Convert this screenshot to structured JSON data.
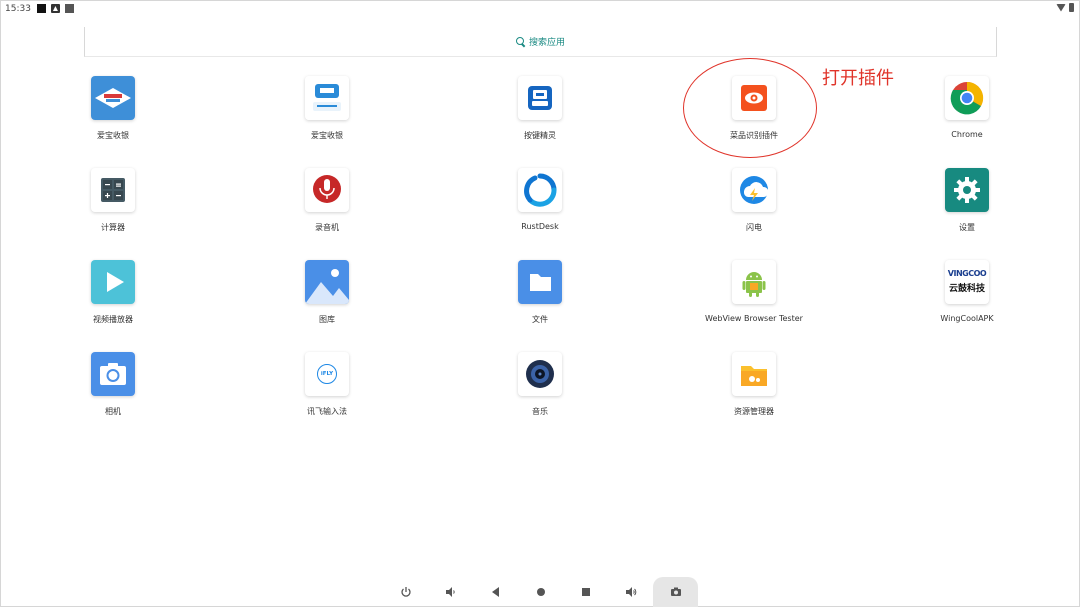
{
  "status_bar": {
    "time": "15:33"
  },
  "search": {
    "label": "搜索应用"
  },
  "annotation": {
    "text": "打开插件",
    "color": "#e0342a"
  },
  "accent_color": "#1a8a83",
  "apps": [
    {
      "label": "爱宝收银",
      "icon": "aibao-pos-icon"
    },
    {
      "label": "爱宝收银",
      "icon": "aibao-pos-alt-icon"
    },
    {
      "label": "按键精灵",
      "icon": "key-wizard-icon"
    },
    {
      "label": "菜品识别插件",
      "icon": "dish-recognition-icon"
    },
    {
      "label": "Chrome",
      "icon": "chrome-icon"
    },
    {
      "label": "计算器",
      "icon": "calculator-icon"
    },
    {
      "label": "录音机",
      "icon": "recorder-icon"
    },
    {
      "label": "RustDesk",
      "icon": "rustdesk-icon"
    },
    {
      "label": "闪电",
      "icon": "lightning-icon"
    },
    {
      "label": "设置",
      "icon": "settings-icon"
    },
    {
      "label": "视频播放器",
      "icon": "video-player-icon"
    },
    {
      "label": "图库",
      "icon": "gallery-icon"
    },
    {
      "label": "文件",
      "icon": "files-icon"
    },
    {
      "label": "WebView Browser Tester",
      "icon": "webview-tester-icon"
    },
    {
      "label": "WingCoolAPK",
      "icon": "wingcool-icon",
      "logo_text": [
        "VINGCOO",
        "云鼓科技"
      ]
    },
    {
      "label": "相机",
      "icon": "camera-icon"
    },
    {
      "label": "讯飞输入法",
      "icon": "iflytek-input-icon",
      "logo_text": "iFLY"
    },
    {
      "label": "音乐",
      "icon": "music-icon"
    },
    {
      "label": "资源管理器",
      "icon": "file-manager-icon"
    }
  ],
  "nav": [
    "power-icon",
    "volume-down-icon",
    "back-icon",
    "home-icon",
    "recents-icon",
    "volume-up-icon",
    "screenshot-icon"
  ]
}
